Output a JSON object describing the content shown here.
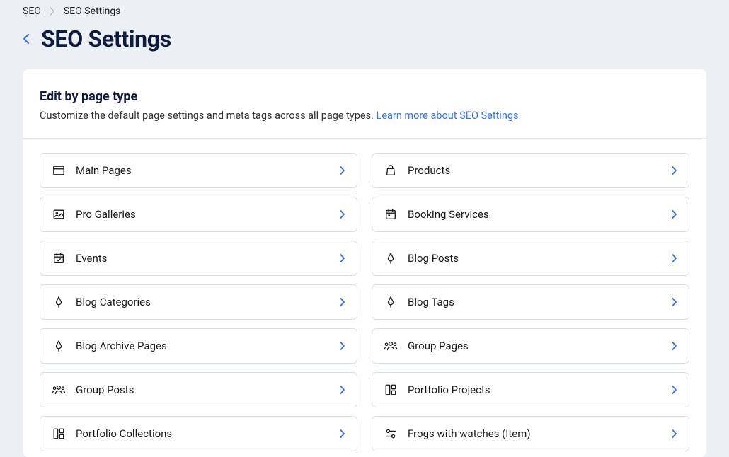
{
  "breadcrumb": {
    "root": "SEO",
    "current": "SEO Settings"
  },
  "page": {
    "title": "SEO Settings"
  },
  "card": {
    "title": "Edit by page type",
    "description": "Customize the default page settings and meta tags across all page types. ",
    "learnMore": "Learn more about SEO Settings"
  },
  "items": [
    {
      "label": "Main Pages",
      "icon": "browser"
    },
    {
      "label": "Products",
      "icon": "bag"
    },
    {
      "label": "Pro Galleries",
      "icon": "gallery"
    },
    {
      "label": "Booking Services",
      "icon": "calendar"
    },
    {
      "label": "Events",
      "icon": "event"
    },
    {
      "label": "Blog Posts",
      "icon": "pen"
    },
    {
      "label": "Blog Categories",
      "icon": "pen"
    },
    {
      "label": "Blog Tags",
      "icon": "pen"
    },
    {
      "label": "Blog Archive Pages",
      "icon": "pen"
    },
    {
      "label": "Group Pages",
      "icon": "group"
    },
    {
      "label": "Group Posts",
      "icon": "group"
    },
    {
      "label": "Portfolio Projects",
      "icon": "portfolio"
    },
    {
      "label": "Portfolio Collections",
      "icon": "portfolio"
    },
    {
      "label": "Frogs with watches (Item)",
      "icon": "filter"
    }
  ]
}
